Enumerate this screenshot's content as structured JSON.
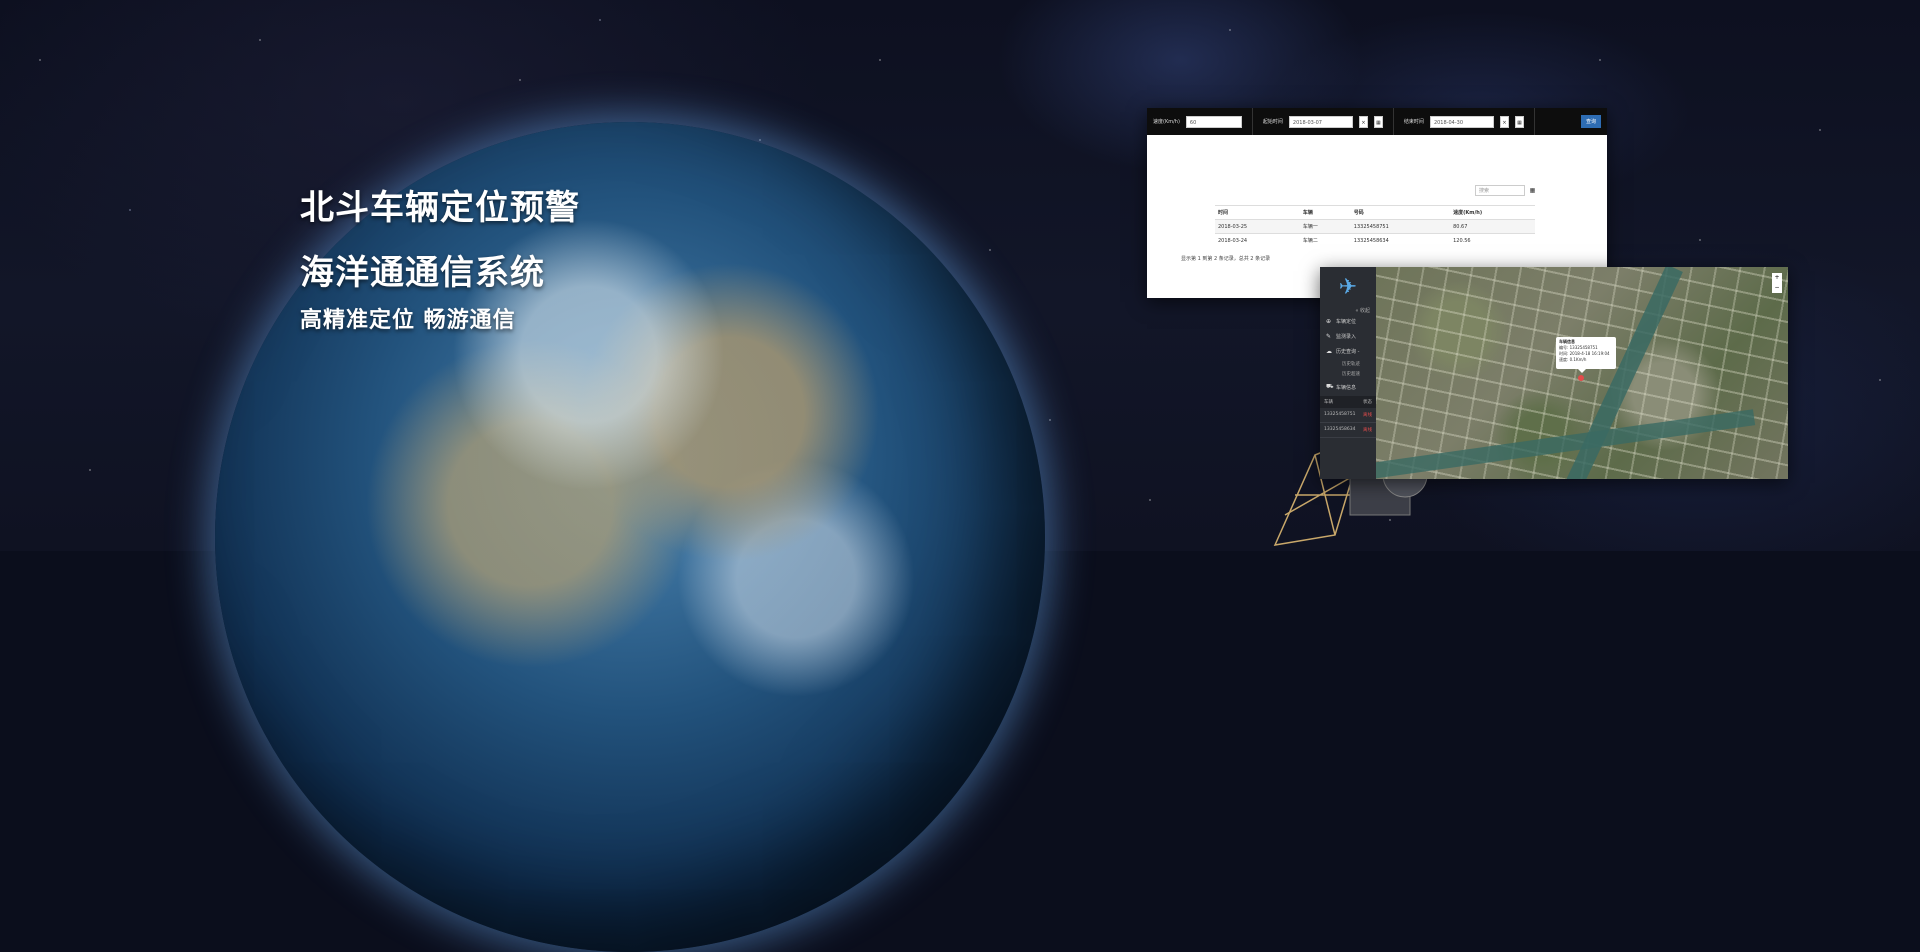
{
  "banner": {
    "title_line1": "北斗车辆定位预警",
    "title_line2": "海洋通通信系统",
    "tagline": "高精准定位 畅游通信"
  },
  "report": {
    "speed_label": "速度(Km/h)",
    "speed_value": "60",
    "start_label": "起始时间",
    "start_value": "2018-03-07",
    "end_label": "结束时间",
    "end_value": "2018-04-30",
    "query_label": "查询",
    "search_placeholder": "搜索",
    "columns": [
      "时间",
      "车辆",
      "号码",
      "速度(Km/h)"
    ],
    "rows": [
      [
        "2018-03-25",
        "车辆一",
        "13325458751",
        "80.67"
      ],
      [
        "2018-03-24",
        "车辆二",
        "13325458634",
        "120.56"
      ]
    ],
    "footer": "显示第 1 到第 2 条记录，总共 2 条记录"
  },
  "map_app": {
    "back_label": "« 收起",
    "nav": [
      "车辆定位",
      "监测录入",
      "历史查询 -",
      "车辆信息"
    ],
    "sub_nav": [
      "历史轨迹",
      "历史超速"
    ],
    "vehicle_table": {
      "headers": [
        "车辆",
        "状态"
      ],
      "rows": [
        [
          "13325458751",
          "离线"
        ],
        [
          "13325458634",
          "离线"
        ]
      ]
    },
    "popup": {
      "title": "车辆信息",
      "line1": "编号: 13325458751",
      "line2": "时间: 2018-4-18 16:19:04",
      "line3": "速度: 0.1Km/h"
    }
  },
  "colors": {
    "accent": "#2e6db4",
    "status_offline": "#e34b4b"
  }
}
